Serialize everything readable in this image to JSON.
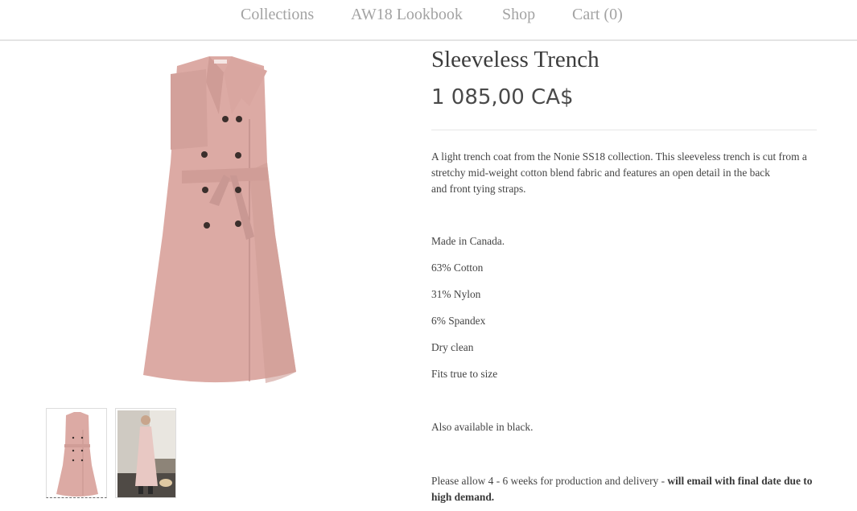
{
  "nav": {
    "collections": "Collections",
    "lookbook": "AW18 Lookbook",
    "shop": "Shop",
    "cart": "Cart (0)"
  },
  "product": {
    "title": "Sleeveless Trench",
    "price": "1 085,00 CA$",
    "description_lines": [
      "A light trench coat from the Nonie SS18 collection. This sleeveless trench is cut from a",
      "stretchy mid-weight cotton blend fabric and features an open detail in the back",
      "and front tying straps."
    ],
    "details": {
      "origin": "Made in Canada.",
      "cotton": "63% Cotton",
      "nylon": "31% Nylon",
      "spandex": "6% Spandex",
      "care": "Dry clean",
      "fit": "Fits true to size"
    },
    "availability": "Also available in black.",
    "delivery_note": "Please allow 4 - 6 weeks for production and delivery - ",
    "delivery_note_bold": "will email with final date due to high demand."
  },
  "colors": {
    "coat": "#dcaaa4",
    "coat_shadow": "#c99893",
    "button": "#3b2f2c",
    "nav_text": "#a3a3a3"
  }
}
